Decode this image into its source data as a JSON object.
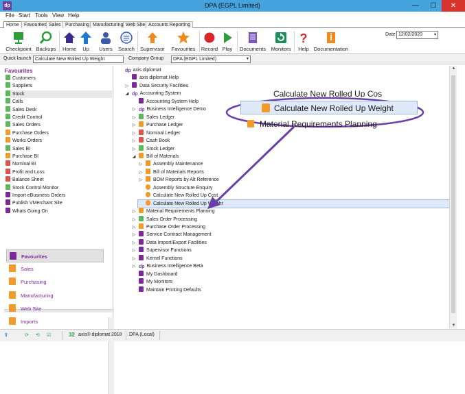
{
  "window": {
    "title": "DPA (EGPL Limited)",
    "app_icon": "dp",
    "minimize": "—",
    "maximize": "☐",
    "close": "✕"
  },
  "menu": [
    "File",
    "Start",
    "Tools",
    "View",
    "Help"
  ],
  "tabs": [
    "Home",
    "Favourites",
    "Sales",
    "Purchasing",
    "Manufacturing",
    "Web Site",
    "Accounts Reporting"
  ],
  "ribbon": {
    "buttons": [
      {
        "label": "Checkpoint",
        "icon": "checkpoint-icon"
      },
      {
        "label": "Backups",
        "icon": "backups-icon"
      },
      {
        "label": "Home",
        "icon": "home-icon"
      },
      {
        "label": "Up",
        "icon": "up-arrow-icon"
      },
      {
        "label": "Users",
        "icon": "users-icon"
      },
      {
        "label": "Search",
        "icon": "search-icon"
      },
      {
        "label": "Supervisor",
        "icon": "supervisor-icon"
      },
      {
        "label": "Favourites",
        "icon": "star-icon"
      },
      {
        "label": "Record",
        "icon": "record-icon"
      },
      {
        "label": "Play",
        "icon": "play-icon"
      },
      {
        "label": "Documents",
        "icon": "documents-icon"
      },
      {
        "label": "Monitors",
        "icon": "monitors-icon"
      },
      {
        "label": "Help",
        "icon": "help-icon"
      },
      {
        "label": "Documentation",
        "icon": "documentation-icon"
      }
    ],
    "date_label": "Date",
    "date_value": "12/02/2020"
  },
  "quick_launch": {
    "label": "Quick launch",
    "value": "Calculate New Rolled Up Weight",
    "company_label": "Company Group",
    "company_value": "DPA (EGPL Limited)"
  },
  "favourites": {
    "title": "Favourites",
    "items": [
      {
        "label": "Customers",
        "color": "#5cb85c"
      },
      {
        "label": "Suppliers",
        "color": "#5cb85c"
      },
      {
        "label": "Stock",
        "color": "#5cb85c"
      },
      {
        "label": "Calls",
        "color": "#5cb85c"
      },
      {
        "label": "Sales Desk",
        "color": "#5cb85c"
      },
      {
        "label": "Credit Control",
        "color": "#5cb85c"
      },
      {
        "label": "Sales Orders",
        "color": "#5cb85c"
      },
      {
        "label": "Purchase Orders",
        "color": "#f29b2a"
      },
      {
        "label": "Works Orders",
        "color": "#f29b2a"
      },
      {
        "label": "Sales BI",
        "color": "#5cb85c"
      },
      {
        "label": "Purchase BI",
        "color": "#f29b2a"
      },
      {
        "label": "Nominal BI",
        "color": "#d9534f"
      },
      {
        "label": "Profit and Loss",
        "color": "#d9534f"
      },
      {
        "label": "Balance Sheet",
        "color": "#d9534f"
      },
      {
        "label": "Stock Control Monitor",
        "color": "#5cb85c"
      },
      {
        "label": "Import eBusiness Orders",
        "color": "#7a2a95"
      },
      {
        "label": "Publish VMerchant Site",
        "color": "#7a2a95"
      },
      {
        "label": "Whats Going On",
        "color": "#7a2a95"
      }
    ],
    "selected": "Stock"
  },
  "nav_buttons": [
    "Favourites",
    "Sales",
    "Purchasing",
    "Manufacturing",
    "Web Site",
    "Imports"
  ],
  "tree": [
    {
      "label": "axis diplomat",
      "level": 0,
      "arrow": "",
      "icon": "dp"
    },
    {
      "label": "axis diplomat Help",
      "level": 1,
      "arrow": "",
      "icon": "doc",
      "color": "#7a2a95"
    },
    {
      "label": "Data Security Facilities",
      "level": 1,
      "arrow": "▷",
      "icon": "doc",
      "color": "#7a2a95"
    },
    {
      "label": "Accounting System",
      "level": 1,
      "arrow": "◢",
      "icon": "dp"
    },
    {
      "label": "Accounting System Help",
      "level": 2,
      "arrow": "",
      "icon": "doc",
      "color": "#7a2a95"
    },
    {
      "label": "Business Intelligence Demo",
      "level": 2,
      "arrow": "▷",
      "icon": "dp"
    },
    {
      "label": "Sales Ledger",
      "level": 2,
      "arrow": "▷",
      "icon": "doc",
      "color": "#5cb85c"
    },
    {
      "label": "Purchase Ledger",
      "level": 2,
      "arrow": "▷",
      "icon": "doc",
      "color": "#f29b2a"
    },
    {
      "label": "Nominal Ledger",
      "level": 2,
      "arrow": "▷",
      "icon": "doc",
      "color": "#d9534f"
    },
    {
      "label": "Cash Book",
      "level": 2,
      "arrow": "▷",
      "icon": "doc",
      "color": "#d9534f"
    },
    {
      "label": "Stock Ledger",
      "level": 2,
      "arrow": "▷",
      "icon": "doc",
      "color": "#5cb85c"
    },
    {
      "label": "Bill of Materials",
      "level": 2,
      "arrow": "◢",
      "icon": "doc",
      "color": "#f29b2a"
    },
    {
      "label": "Assembly Maintenance",
      "level": 3,
      "arrow": "▷",
      "icon": "doc",
      "color": "#f29b2a"
    },
    {
      "label": "Bill of Materials Reports",
      "level": 3,
      "arrow": "▷",
      "icon": "doc",
      "color": "#f29b2a"
    },
    {
      "label": "BOM Reports by Alt Reference",
      "level": 3,
      "arrow": "▷",
      "icon": "doc",
      "color": "#f29b2a"
    },
    {
      "label": "Assembly Structure Enquiry",
      "level": 3,
      "arrow": "",
      "icon": "gear",
      "color": "#f29b2a"
    },
    {
      "label": "Calculate New Rolled Up Cost",
      "level": 3,
      "arrow": "",
      "icon": "gear",
      "color": "#f29b2a"
    },
    {
      "label": "Calculate New Rolled Up Weight",
      "level": 3,
      "arrow": "",
      "icon": "gear",
      "color": "#f29b2a",
      "selected": true
    },
    {
      "label": "Material Requirements Planning",
      "level": 2,
      "arrow": "▷",
      "icon": "doc",
      "color": "#f29b2a"
    },
    {
      "label": "Sales Order Processing",
      "level": 2,
      "arrow": "▷",
      "icon": "doc",
      "color": "#5cb85c"
    },
    {
      "label": "Purchase Order Processing",
      "level": 2,
      "arrow": "▷",
      "icon": "doc",
      "color": "#f29b2a"
    },
    {
      "label": "Service Contract Management",
      "level": 2,
      "arrow": "▷",
      "icon": "doc",
      "color": "#7a2a95"
    },
    {
      "label": "Data Import/Export Facilities",
      "level": 2,
      "arrow": "▷",
      "icon": "doc",
      "color": "#7a2a95"
    },
    {
      "label": "Supervisor Functions",
      "level": 2,
      "arrow": "▷",
      "icon": "doc",
      "color": "#7a2a95"
    },
    {
      "label": "Kernel Functions",
      "level": 2,
      "arrow": "▷",
      "icon": "doc",
      "color": "#7a2a95"
    },
    {
      "label": "Business Intelligence Beta",
      "level": 2,
      "arrow": "▷",
      "icon": "dp"
    },
    {
      "label": "My Dashboard",
      "level": 2,
      "arrow": "",
      "icon": "doc",
      "color": "#7a2a95"
    },
    {
      "label": "My Monitors",
      "level": 2,
      "arrow": "",
      "icon": "doc",
      "color": "#7a2a95"
    },
    {
      "label": "Maintain Printing Defaults",
      "level": 2,
      "arrow": "",
      "icon": "doc",
      "color": "#7a2a95"
    }
  ],
  "callout": {
    "top_text": "Calculate New Rolled Up Cost",
    "highlighted": "Calculate New Rolled Up Weight",
    "below": "Material Requirements Planning",
    "accent": "#6a3fa6"
  },
  "status": {
    "count": "32",
    "product": "axis® diplomat 2018",
    "company": "DPA (Local)"
  }
}
